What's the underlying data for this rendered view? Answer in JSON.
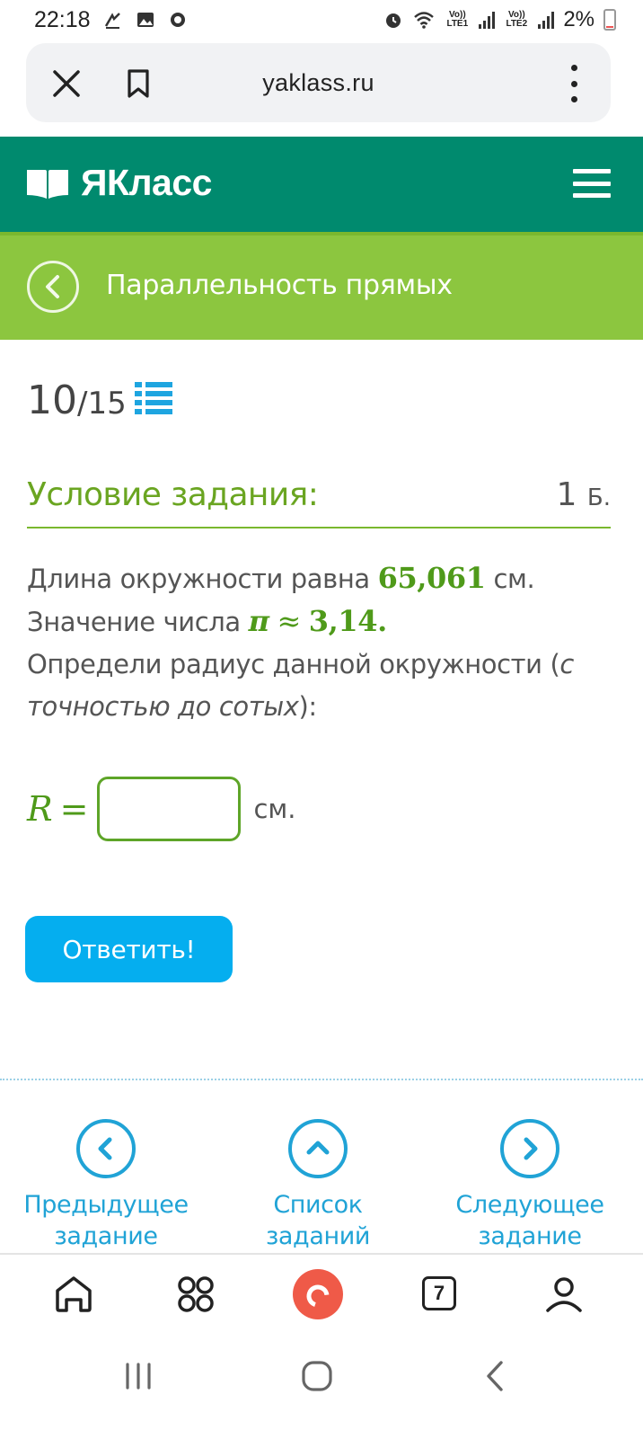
{
  "status": {
    "time": "22:18",
    "battery": "2%",
    "sim1": "Vo)) LTE1",
    "sim2": "Vo)) LTE2"
  },
  "browser": {
    "url": "yaklass.ru"
  },
  "header": {
    "logo_text": "ЯКласс"
  },
  "topic": {
    "title": "Параллельность прямых"
  },
  "progress": {
    "current": "10",
    "total": "/15"
  },
  "condition": {
    "title": "Условие задания:",
    "points": "1",
    "points_unit": "Б."
  },
  "task": {
    "t1": "Длина окружности равна ",
    "length_value": "65,061",
    "t2": " см. Значение числа ",
    "pi": "π",
    "approx": "≈",
    "pi_value": "3,14.",
    "t3": "Определи радиус данной окружности (",
    "t3_italic": "с точностью до сотых",
    "t4": "):"
  },
  "answer": {
    "label": "R",
    "eq": "=",
    "value": "",
    "unit": "см."
  },
  "submit_label": "Ответить!",
  "nav": {
    "prev_line1": "Предыдущее",
    "prev_line2": "задание",
    "list_line1": "Список",
    "list_line2": "заданий",
    "next_line1": "Следующее",
    "next_line2": "задание"
  },
  "bottom_bar": {
    "tabs_count": "7"
  },
  "colors": {
    "header_bg": "#008a6e",
    "topic_bg": "#8cc63f",
    "accent_green": "#6aa521",
    "button_blue": "#05aeef",
    "link_blue": "#20a3d6",
    "alice_red": "#ef5a48"
  }
}
